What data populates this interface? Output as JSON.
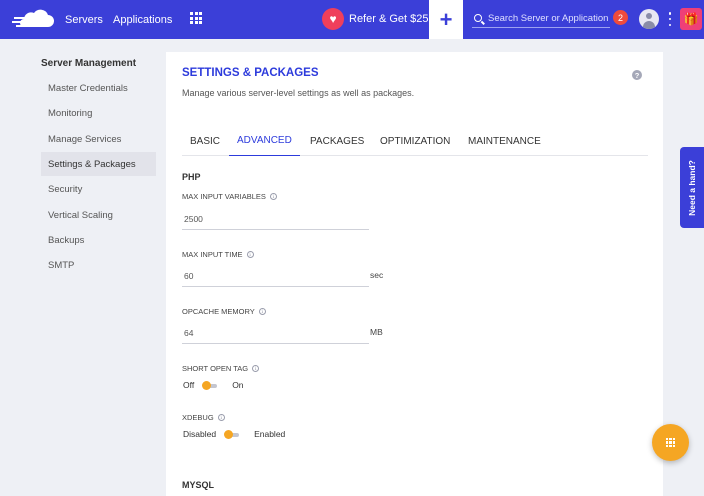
{
  "topbar": {
    "nav": [
      "Servers",
      "Applications"
    ],
    "refer_label": "Refer & Get $25",
    "search_placeholder": "Search Server or Application",
    "notification_count": "2",
    "icons": [
      "cloudways-logo-icon",
      "apps-grid-icon",
      "heart-icon",
      "plus-icon",
      "search-icon",
      "user-avatar-icon",
      "kebab-menu-icon",
      "gift-icon"
    ],
    "colors": {
      "bar": "#3b3fd8",
      "heart": "#ef3f5b",
      "badge": "#ef4b3c",
      "gift": "#ef3f77"
    }
  },
  "sidebar": {
    "title": "Server Management",
    "items": [
      "Master Credentials",
      "Monitoring",
      "Manage Services",
      "Settings & Packages",
      "Security",
      "Vertical Scaling",
      "Backups",
      "SMTP"
    ],
    "active_index": 3
  },
  "card": {
    "title": "SETTINGS & PACKAGES",
    "subtitle": "Manage various server-level settings as well as packages.",
    "help_icon": "?",
    "tabs": [
      "BASIC",
      "ADVANCED",
      "PACKAGES",
      "OPTIMIZATION",
      "MAINTENANCE"
    ],
    "active_tab": "ADVANCED",
    "php_section": "PHP",
    "fields": [
      {
        "label": "MAX INPUT VARIABLES",
        "value": "2500",
        "unit": ""
      },
      {
        "label": "MAX INPUT TIME",
        "value": "60",
        "unit": "sec"
      },
      {
        "label": "OPCACHE MEMORY",
        "value": "64",
        "unit": "MB"
      }
    ],
    "toggles": [
      {
        "label": "SHORT OPEN TAG",
        "off_label": "Off",
        "on_label": "On",
        "state": "off"
      },
      {
        "label": "XDEBUG",
        "off_label": "Disabled",
        "on_label": "Enabled",
        "state": "off"
      }
    ],
    "mysql_section": "MYSQL",
    "info_glyph": "i"
  },
  "floating": {
    "need_hand": "Need a hand?",
    "fab_icon": "apps-grid-icon",
    "accent": "#f5a623"
  }
}
